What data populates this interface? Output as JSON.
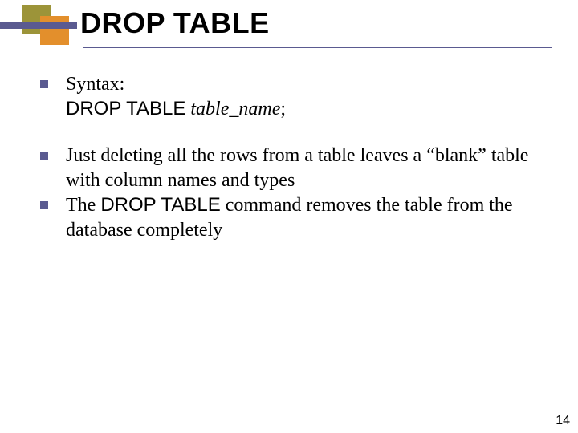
{
  "decoration": {
    "olive": "#9c9439",
    "orange": "#e38f2c",
    "purple": "#5a5a90"
  },
  "title": "DROP TABLE",
  "bullets": [
    {
      "lead": "Syntax:",
      "syntax_cmd": "DROP TABLE",
      "syntax_arg": "table_name",
      "syntax_tail": ";"
    },
    {
      "text_before": "Just deleting all the rows from a table leaves a “blank” table with column names and types"
    },
    {
      "text_before": "The ",
      "inline_cmd": "DROP TABLE",
      "text_after": " command removes the table from the database completely"
    }
  ],
  "page_number": "14"
}
